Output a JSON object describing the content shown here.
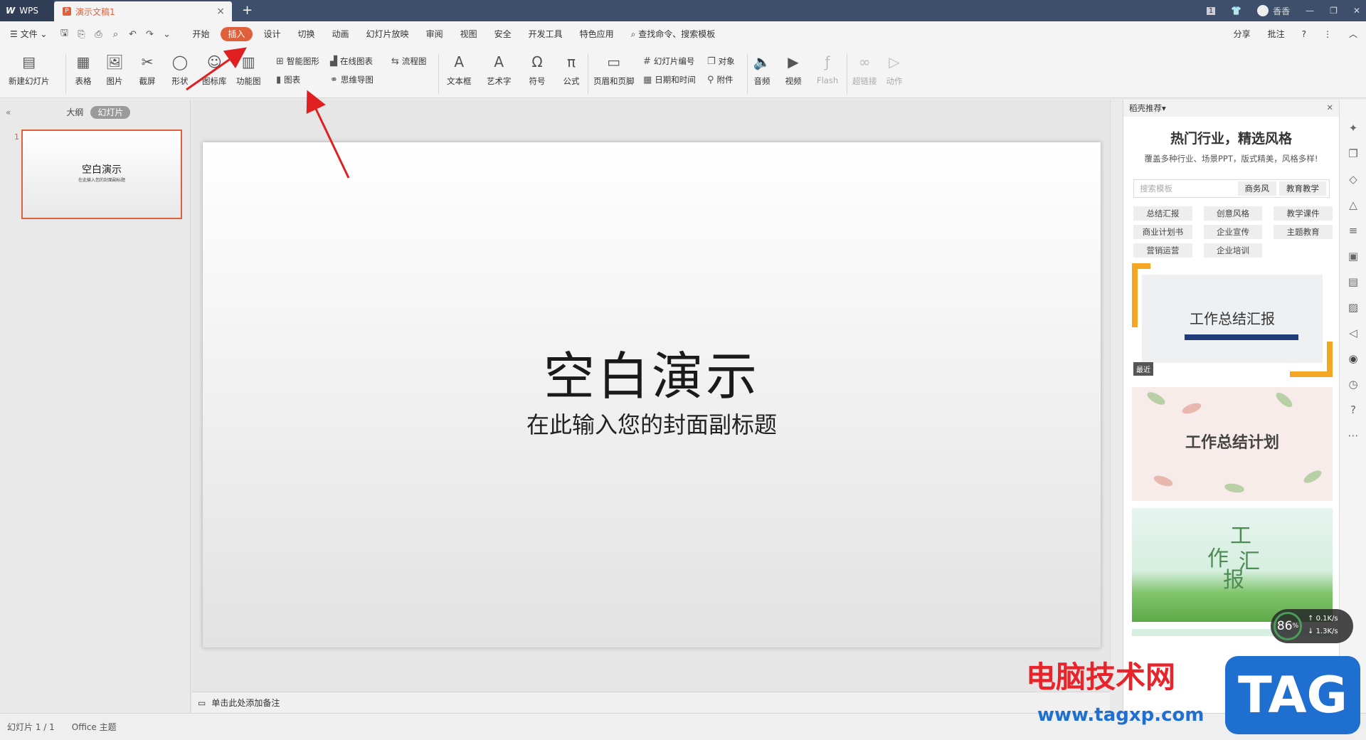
{
  "titlebar": {
    "app_tab": "WPS",
    "doc_tab": "演示文稿1",
    "user": "香香",
    "page_num": "1"
  },
  "menu": {
    "file": "文件",
    "items": [
      "开始",
      "插入",
      "设计",
      "切换",
      "动画",
      "幻灯片放映",
      "审阅",
      "视图",
      "安全",
      "开发工具",
      "特色应用"
    ],
    "active": "插入",
    "search": "查找命令、搜索模板",
    "share": "分享",
    "comment": "批注",
    "help": "?"
  },
  "ribbon": {
    "new_slide": "新建幻灯片",
    "table": "表格",
    "picture": "图片",
    "screenshot": "截屏",
    "shape": "形状",
    "icon_lib": "图标库",
    "func_chart": "功能图",
    "smart_shape": "智能图形",
    "online_chart": "在线图表",
    "flowchart": "流程图",
    "chart": "图表",
    "mindmap": "思维导图",
    "textbox": "文本框",
    "wordart": "艺术字",
    "symbol": "符号",
    "formula": "公式",
    "header_footer": "页眉和页脚",
    "slide_number": "幻灯片编号",
    "object": "对象",
    "datetime": "日期和时间",
    "attachment": "附件",
    "audio": "音频",
    "video": "视频",
    "flash": "Flash",
    "hyperlink": "超链接",
    "action": "动作"
  },
  "left_panel": {
    "tab_outline": "大纲",
    "tab_slides": "幻灯片",
    "slide_index": "1",
    "thumb_title": "空白演示",
    "thumb_sub": "在此输入您的封面副标题"
  },
  "slide": {
    "title": "空白演示",
    "subtitle": "在此输入您的封面副标题"
  },
  "notes": {
    "placeholder": "单击此处添加备注"
  },
  "right_panel": {
    "header": "稻壳推荐",
    "title": "热门行业，精选风格",
    "desc": "覆盖多种行业、场景PPT，版式精美，风格多样!",
    "search_placeholder": "搜索模板",
    "search_tags": [
      "商务风",
      "教育教学"
    ],
    "tags": [
      "总结汇报",
      "创意风格",
      "教学课件",
      "商业计划书",
      "企业宣传",
      "主题教育",
      "营销运营",
      "企业培训"
    ],
    "tpl1_title": "工作总结汇报",
    "tpl1_badge": "最近",
    "tpl2_title": "工作总结计划",
    "tpl3_chars": [
      "工",
      "作",
      "汇",
      "报"
    ]
  },
  "statusbar": {
    "slide_count": "幻灯片 1 / 1",
    "theme": "Office 主题"
  },
  "speed": {
    "percent": "86",
    "unit": "%",
    "up": "0.1",
    "down": "1.3",
    "rate_unit": "K/s"
  },
  "watermark": {
    "text": "电脑技术网",
    "url": "www.tagxp.com",
    "tag": "TAG"
  },
  "colors": {
    "accent": "#e0603b",
    "titlebar": "#3d4f6a",
    "arrow": "#e02020"
  }
}
